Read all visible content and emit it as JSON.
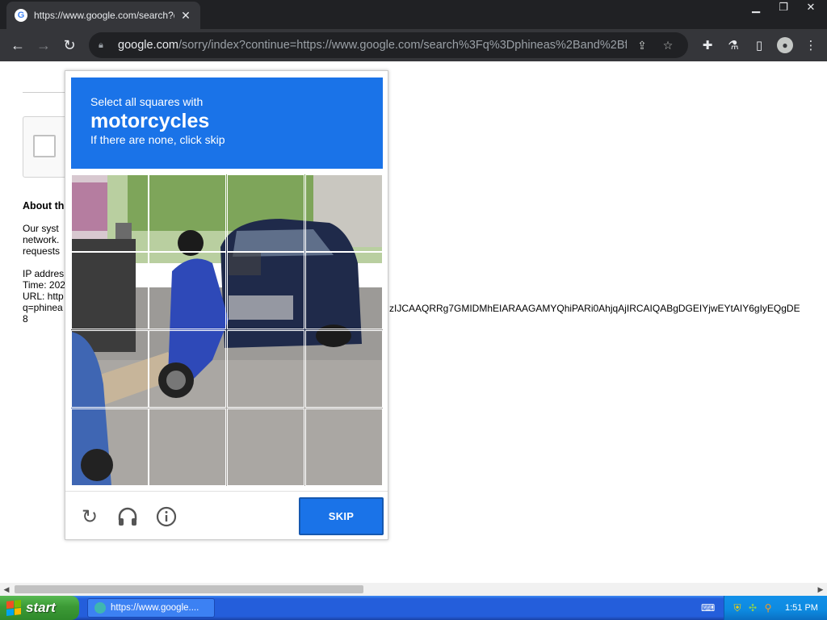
{
  "browser": {
    "tab_title": "https://www.google.com/search?q=",
    "tab_favicon": "G",
    "url_host": "google.com",
    "url_rest": "/sorry/index?continue=https://www.google.com/search%3Fq%3Dphineas%2Band%2Bfer..."
  },
  "page": {
    "about_title": "About th",
    "lines": [
      "Our syst",
      "network.",
      "requests",
      "IP addres",
      "Time: 202",
      "URL: http",
      "q=phinea",
      "8"
    ],
    "url_tail": "zIJCAAQRRg7GMIDMhEIARAAGAMYQhiPARi0AhjqAjIRCAIQABgDGEIYjwEYtAIY6gIyEQgDE"
  },
  "captcha": {
    "instruction": "Select all squares with",
    "target": "motorcycles",
    "hint": "If there are none, click skip",
    "skip_label": "SKIP"
  },
  "taskbar": {
    "start_label": "start",
    "task_label": "https://www.google....",
    "clock": "1:51 PM"
  }
}
